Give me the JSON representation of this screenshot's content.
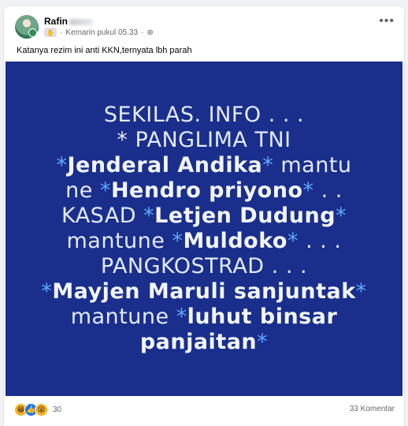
{
  "post": {
    "author": "Rafin",
    "timestamp": "Kemarin pukul 05.33",
    "text": "Katanya rezim ini anti KKN,ternyata lbh parah",
    "more_label": "•••"
  },
  "image": {
    "background": "#1a2e8c",
    "lines": [
      "SEKILAS. INFO . . .",
      "* PANGLIMA TNI",
      [
        "*",
        "Jenderal Andika",
        "*  mantu"
      ],
      [
        "ne *",
        "Hendro priyono",
        "* . ."
      ],
      [
        "KASAD  *",
        "Letjen Dudung",
        "*"
      ],
      [
        "mantune  *",
        "Muldoko",
        "* . . ."
      ],
      "PANGKOSTRAD . . .",
      [
        "*",
        "Majen Maruli sanjuntak",
        "*"
      ],
      [
        "mantune *",
        "luhut binsar",
        ""
      ],
      [
        "",
        "panjaitan",
        "*"
      ]
    ],
    "text_lines": {
      "l1": "SEKILAS. INFO . . .",
      "l2": "* PANGLIMA TNI",
      "l3a": "*",
      "l3b": "Jenderal Andika",
      "l3c": "*",
      "l3d": "  mantu",
      "l4a": "ne ",
      "l4b": "*",
      "l4c": "Hendro priyono",
      "l4d": "*",
      "l4e": " . .",
      "l5a": "KASAD  ",
      "l5b": "*",
      "l5c": "Letjen Dudung",
      "l5d": "*",
      "l6a": "mantune  ",
      "l6b": "*",
      "l6c": "Muldoko",
      "l6d": "*",
      "l6e": " . . .",
      "l7": "PANGKOSTRAD . . .",
      "l8a": "*",
      "l8b": "Mayjen Maruli sanjuntak",
      "l8c": "*",
      "l9a": "mantune ",
      "l9b": "*",
      "l9c": "luhut binsar",
      "l10a": "panjaitan",
      "l10b": "*"
    }
  },
  "engagement": {
    "reactions": [
      "haha",
      "like",
      "wow"
    ],
    "reaction_count": "30",
    "comments": "33 Komentar"
  }
}
